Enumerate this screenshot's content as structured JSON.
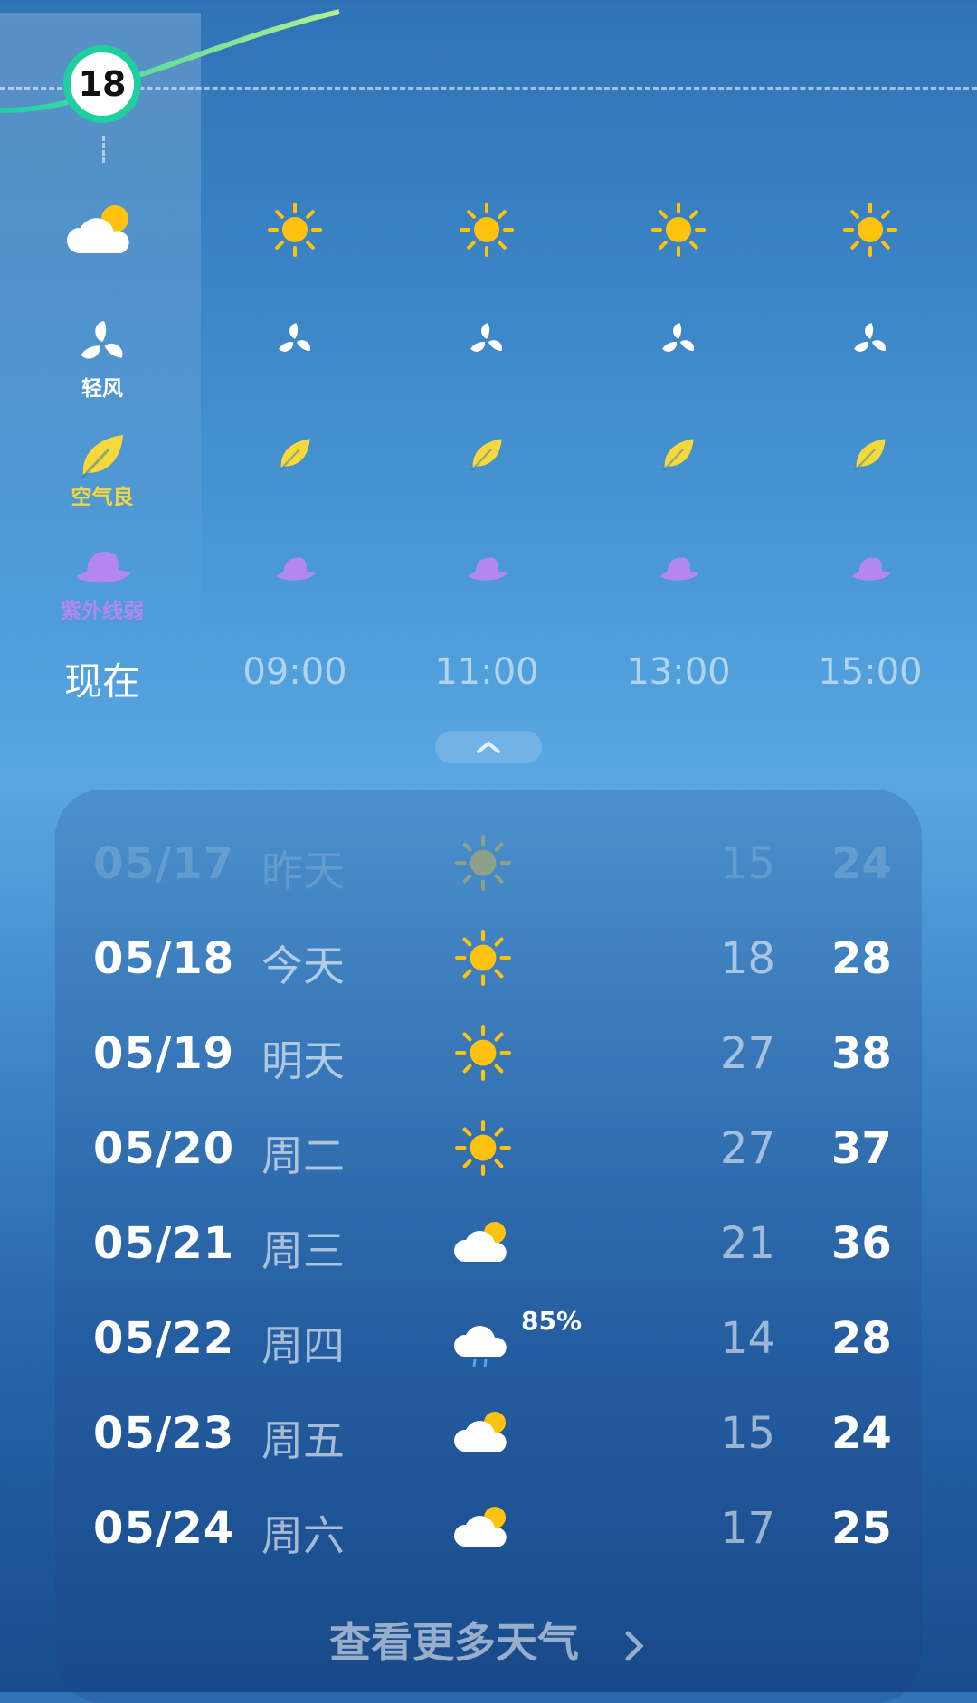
{
  "current": {
    "temperature": "18",
    "wind_label": "轻风",
    "air_label": "空气良",
    "uv_label": "紫外线弱",
    "now_label": "现在"
  },
  "hourly": [
    {
      "time": "09:00",
      "weather_icon": "sun-icon"
    },
    {
      "time": "11:00",
      "weather_icon": "sun-icon"
    },
    {
      "time": "13:00",
      "weather_icon": "sun-icon"
    },
    {
      "time": "15:00",
      "weather_icon": "sun-icon"
    }
  ],
  "daily": [
    {
      "date": "05/17",
      "name": "昨天",
      "icon": "sun-icon",
      "low": "15",
      "high": "24",
      "past": true
    },
    {
      "date": "05/18",
      "name": "今天",
      "icon": "sun-icon",
      "low": "18",
      "high": "28"
    },
    {
      "date": "05/19",
      "name": "明天",
      "icon": "sun-icon",
      "low": "27",
      "high": "38"
    },
    {
      "date": "05/20",
      "name": "周二",
      "icon": "sun-icon",
      "low": "27",
      "high": "37"
    },
    {
      "date": "05/21",
      "name": "周三",
      "icon": "partly-cloudy-icon",
      "low": "21",
      "high": "36"
    },
    {
      "date": "05/22",
      "name": "周四",
      "icon": "rain-cloud-icon",
      "precip": "85%",
      "low": "14",
      "high": "28"
    },
    {
      "date": "05/23",
      "name": "周五",
      "icon": "partly-cloudy-icon",
      "low": "15",
      "high": "24"
    },
    {
      "date": "05/24",
      "name": "周六",
      "icon": "partly-cloudy-icon",
      "low": "17",
      "high": "25"
    }
  ],
  "more_label": "查看更多天气",
  "colors": {
    "sun": "#ffc20e",
    "leaf": "#f5d93a",
    "uv": "#b487f0",
    "temp_ring": "#1fcf9f",
    "rain_drop": "#4aa8ff"
  }
}
